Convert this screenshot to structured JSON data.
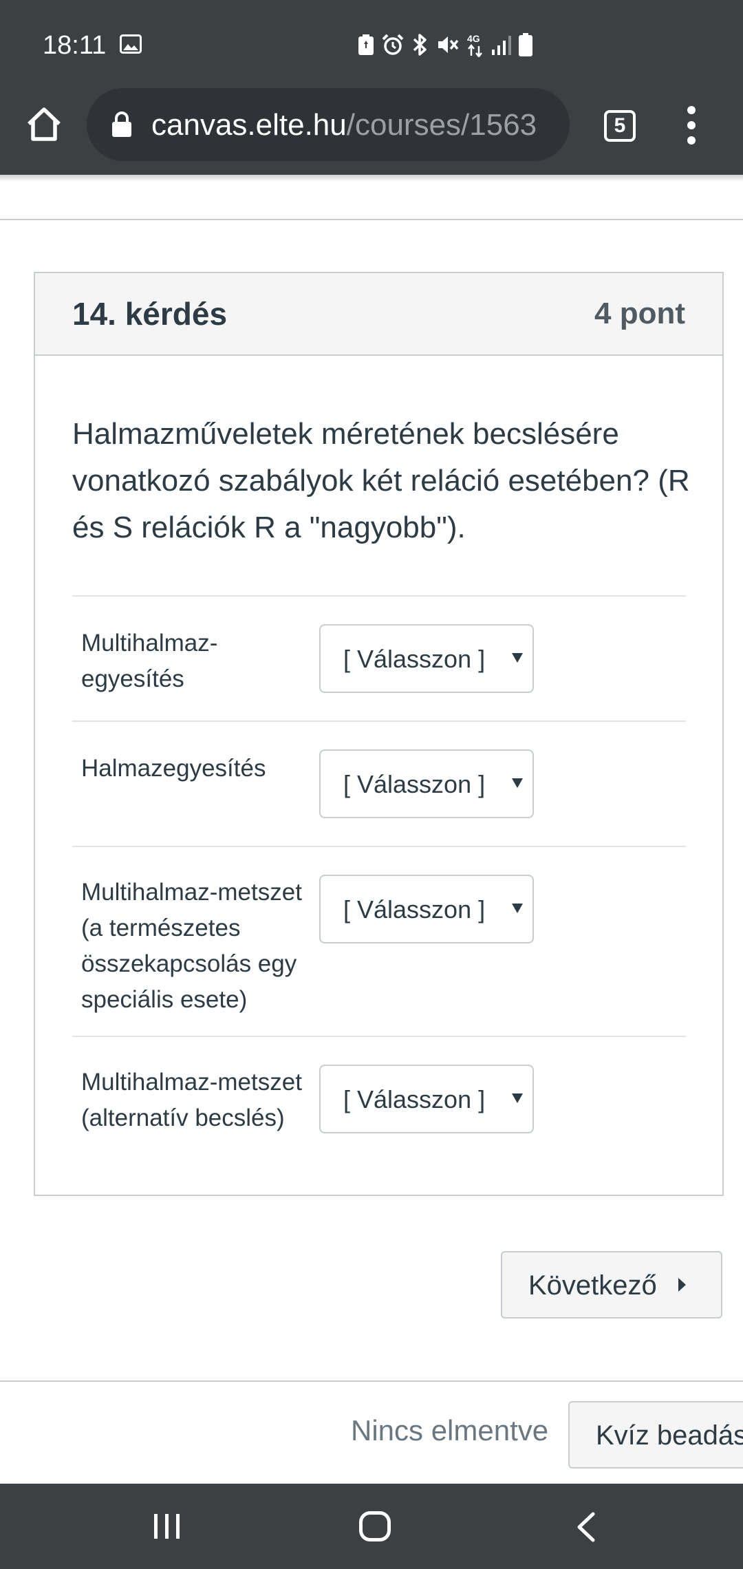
{
  "status_bar": {
    "time": "18:11",
    "network_label": "4G",
    "icons": [
      "image-icon",
      "battery-saver-icon",
      "alarm-icon",
      "bluetooth-icon",
      "mute-icon",
      "network-4g-icon",
      "signal-icon",
      "battery-icon"
    ]
  },
  "browser": {
    "url_host": "canvas.elte.hu",
    "url_path": "/courses/1563",
    "tab_count": "5",
    "icons": [
      "home-icon",
      "lock-icon",
      "tab-switcher-icon",
      "more-menu-icon"
    ]
  },
  "question": {
    "title": "14. kérdés",
    "points": "4 pont",
    "text": "Halmazműveletek méretének becslésére vonatkozó szabályok két reláció esetében? (R és S relációk R a \"nagyobb\").",
    "rows": [
      {
        "label": "Multihalmaz-egyesítés",
        "selected": "[ Válasszon ]"
      },
      {
        "label": "Halmazegyesítés",
        "selected": "[ Válasszon ]"
      },
      {
        "label": "Multihalmaz-metszet (a természetes összekapcsolás egy speciális esete)",
        "selected": "[ Válasszon ]"
      },
      {
        "label": "Multihalmaz-metszet (alternatív becslés)",
        "selected": "[ Válasszon ]"
      }
    ]
  },
  "footer": {
    "next_label": "Következő",
    "save_status": "Nincs elmentve",
    "submit_label": "Kvíz beadása"
  },
  "colors": {
    "system_bar": "#3c4043",
    "text": "#2d3b45",
    "border": "#c7cdd1",
    "header_bg": "#f5f5f5"
  }
}
